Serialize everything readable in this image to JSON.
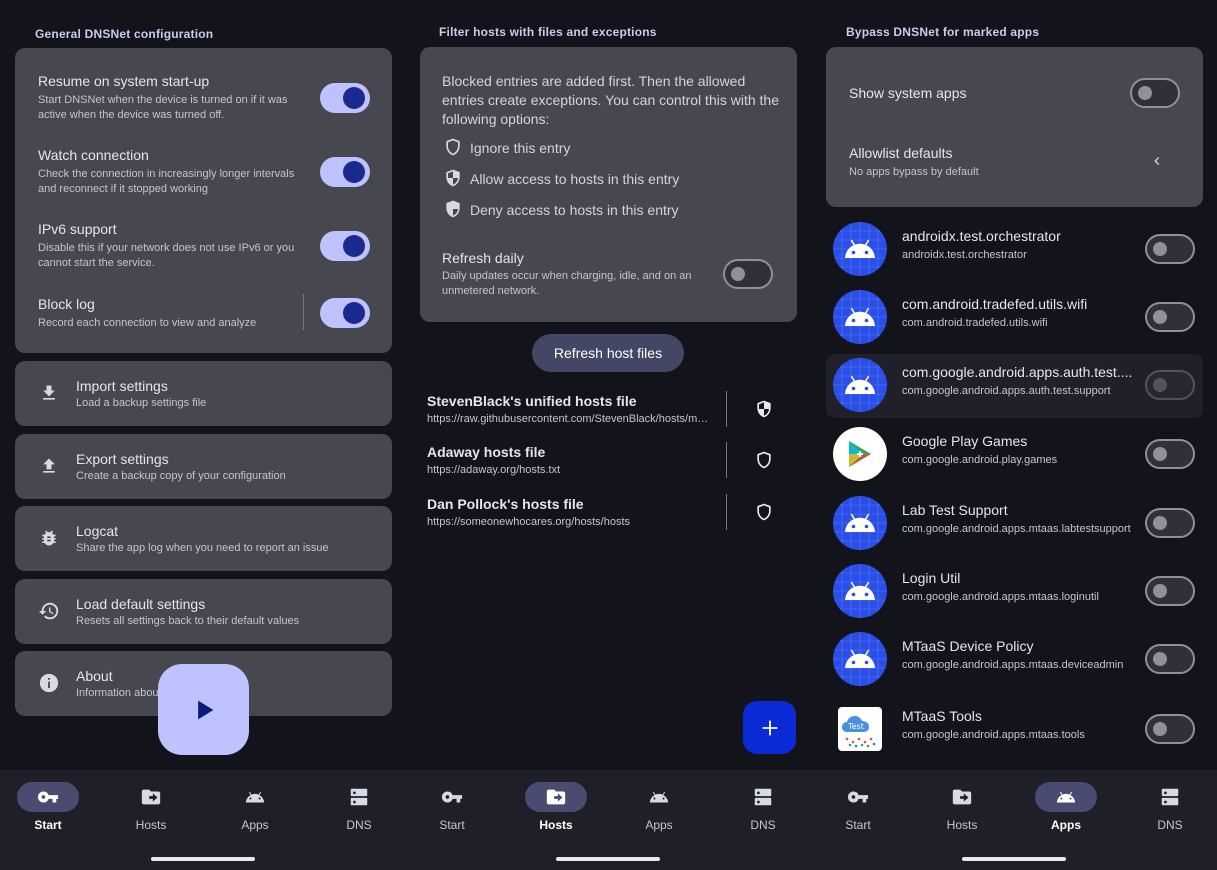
{
  "start": {
    "section_title": "General DNSNet configuration",
    "resume": {
      "title": "Resume on system start-up",
      "sub": "Start DNSNet when the device is turned on if it was active when the device was turned off.",
      "on": true
    },
    "watch": {
      "title": "Watch connection",
      "sub": "Check the connection in increasingly longer intervals and reconnect if it stopped working",
      "on": true
    },
    "ipv6": {
      "title": "IPv6 support",
      "sub": "Disable this if your network does not use IPv6 or you cannot start the service.",
      "on": true
    },
    "blocklog": {
      "title": "Block log",
      "sub": "Record each connection to view and analyze",
      "on": true
    },
    "actions": [
      {
        "title": "Import settings",
        "sub": "Load a backup settings file",
        "icon": "download-icon"
      },
      {
        "title": "Export settings",
        "sub": "Create a backup copy of your configuration",
        "icon": "upload-icon"
      },
      {
        "title": "Logcat",
        "sub": "Share the app log when you need to report an issue",
        "icon": "bug-icon"
      },
      {
        "title": "Load default settings",
        "sub": "Resets all settings back to their default values",
        "icon": "history-icon"
      },
      {
        "title": "About",
        "sub": "Information about",
        "icon": "info-icon"
      }
    ],
    "fab_icon": "play-icon"
  },
  "hosts": {
    "section_title": "Filter hosts with files and exceptions",
    "intro": "Blocked entries are added first. Then the allowed entries create exceptions. You can control this with the following options:",
    "options": [
      {
        "label": "Ignore this entry",
        "icon": "shield-outline-icon"
      },
      {
        "label": "Allow access to hosts in this entry",
        "icon": "shield-half-icon"
      },
      {
        "label": "Deny access to hosts in this entry",
        "icon": "shield-filled-icon"
      }
    ],
    "refresh_daily": {
      "title": "Refresh daily",
      "sub": "Daily updates occur when charging, idle, and on an unmetered network.",
      "on": false
    },
    "refresh_button": "Refresh host files",
    "files": [
      {
        "title": "StevenBlack's unified hosts file",
        "url": "https://raw.githubusercontent.com/StevenBlack/hosts/master/hosts",
        "icon": "shield-half-icon"
      },
      {
        "title": "Adaway hosts file",
        "url": "https://adaway.org/hosts.txt",
        "icon": "shield-outline-icon"
      },
      {
        "title": "Dan Pollock's hosts file",
        "url": "https://someonewhocares.org/hosts/hosts",
        "icon": "shield-outline-icon"
      }
    ],
    "fab_icon": "plus-icon"
  },
  "apps": {
    "section_title": "Bypass DNSNet for marked apps",
    "show_system": {
      "title": "Show system apps",
      "on": false
    },
    "allowlist": {
      "title": "Allowlist defaults",
      "sub": "No apps bypass by default"
    },
    "list": [
      {
        "name": "androidx.test.orchestrator",
        "pkg": "androidx.test.orchestrator",
        "icon": "android-icon"
      },
      {
        "name": "com.android.tradefed.utils.wifi",
        "pkg": "com.android.tradefed.utils.wifi",
        "icon": "android-icon"
      },
      {
        "name": "com.google.android.apps.auth.test....",
        "pkg": "com.google.android.apps.auth.test.support",
        "icon": "android-icon"
      },
      {
        "name": "Google Play Games",
        "pkg": "com.google.android.play.games",
        "icon": "play-games-icon"
      },
      {
        "name": "Lab Test Support",
        "pkg": "com.google.android.apps.mtaas.labtestsupport",
        "icon": "android-icon"
      },
      {
        "name": "Login Util",
        "pkg": "com.google.android.apps.mtaas.loginutil",
        "icon": "android-icon"
      },
      {
        "name": "MTaaS Device Policy",
        "pkg": "com.google.android.apps.mtaas.deviceadmin",
        "icon": "android-icon"
      },
      {
        "name": "MTaaS Tools",
        "pkg": "com.google.android.apps.mtaas.tools",
        "icon": "test-cloud-icon",
        "icon_text": "Test"
      }
    ]
  },
  "nav": {
    "items": [
      {
        "label": "Start",
        "icon": "key-icon"
      },
      {
        "label": "Hosts",
        "icon": "hosts-icon"
      },
      {
        "label": "Apps",
        "icon": "android-icon"
      },
      {
        "label": "DNS",
        "icon": "dns-icon"
      }
    ]
  },
  "colors": {
    "background": "#12131b",
    "card": "#46474f",
    "switch_on_track": "#bec3ff",
    "switch_on_knob": "#1a2a8f",
    "nav_active_pill": "#494c70",
    "fab_primary": "#0a2bd6",
    "fab_start": "#bec3ff",
    "android_icon_bg": "#2a4fe8"
  }
}
